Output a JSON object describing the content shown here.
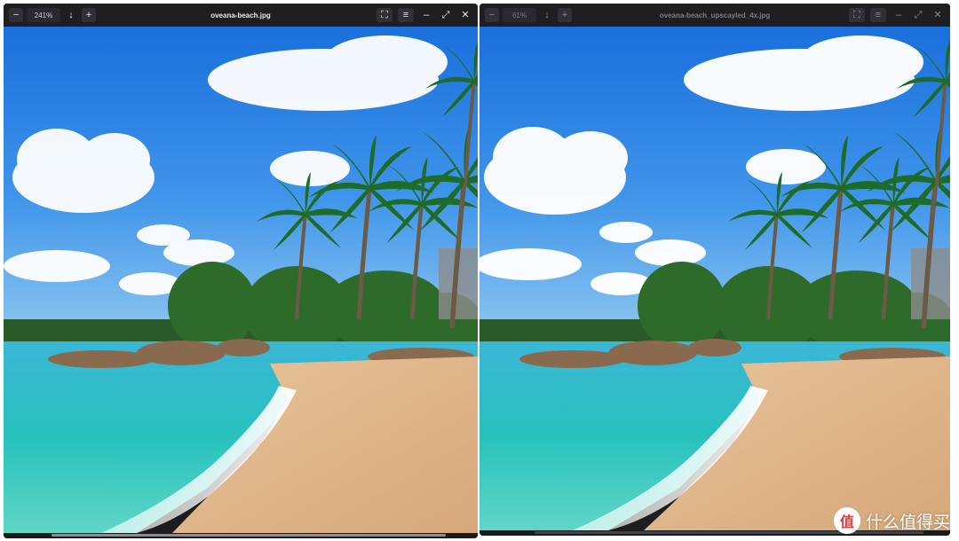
{
  "left_viewer": {
    "zoom": "241%",
    "filename": "oveana-beach.jpg",
    "icons": {
      "zoom_out": "minus-square-icon",
      "download": "arrow-down-icon",
      "zoom_in": "plus-square-icon",
      "fullscreen": "fullscreen-icon",
      "menu": "hamburger-menu-icon",
      "minimize": "minimize-icon",
      "maximize": "maximize-icon",
      "close": "close-icon"
    },
    "image_alt": "Tropical beach with palm trees and blue sky"
  },
  "right_viewer": {
    "zoom": "61%",
    "filename": "oveana-beach_upscayled_4x.jpg",
    "image_alt": "Upscaled tropical beach with palm trees and blue sky"
  },
  "watermark": {
    "badge": "值",
    "text": "什么值得买"
  },
  "colors": {
    "titlebar": "#1f1f22",
    "sky": "#1f7be0",
    "sea": "#2cc0c8",
    "sand": "#e2b98a"
  }
}
